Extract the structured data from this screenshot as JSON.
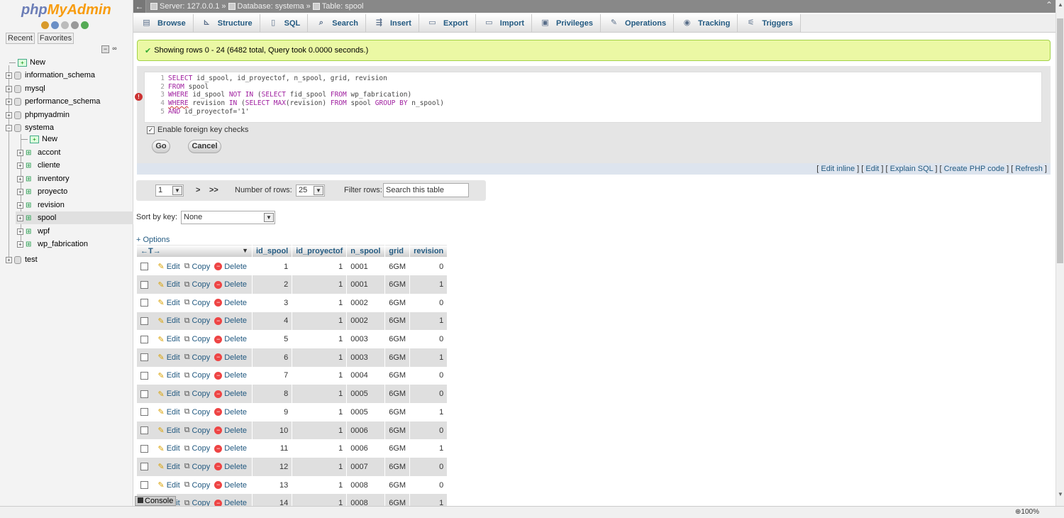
{
  "logo": {
    "part1": "php",
    "part2": "MyAdmin"
  },
  "nav": {
    "recent": "Recent",
    "favorites": "Favorites",
    "new_label": "New",
    "databases": [
      {
        "name": "information_schema"
      },
      {
        "name": "mysql"
      },
      {
        "name": "performance_schema"
      },
      {
        "name": "phpmyadmin"
      },
      {
        "name": "systema"
      },
      {
        "name": "test"
      }
    ],
    "systema_new": "New",
    "tables": [
      "accont",
      "cliente",
      "inventory",
      "proyecto",
      "revision",
      "spool",
      "wpf",
      "wp_fabrication"
    ]
  },
  "breadcrumb": {
    "server": "Server: 127.0.0.1",
    "database": "Database: systema",
    "table": "Table: spool"
  },
  "tabs": [
    "Browse",
    "Structure",
    "SQL",
    "Search",
    "Insert",
    "Export",
    "Import",
    "Privileges",
    "Operations",
    "Tracking",
    "Triggers"
  ],
  "success_message": "Showing rows 0 - 24 (6482 total, Query took 0.0000 seconds.)",
  "sql": {
    "lines": [
      {
        "n": "1",
        "parts": [
          [
            "kw",
            "SELECT"
          ],
          [
            "ct",
            " id_spool, id_proyectof, n_spool, grid, revision"
          ]
        ]
      },
      {
        "n": "2",
        "parts": [
          [
            "kw",
            "FROM"
          ],
          [
            "ct",
            " spool"
          ]
        ]
      },
      {
        "n": "3",
        "parts": [
          [
            "kw",
            "WHERE"
          ],
          [
            "ct",
            " id_spool "
          ],
          [
            "kw",
            "NOT IN"
          ],
          [
            "ct",
            " ("
          ],
          [
            "kw",
            "SELECT"
          ],
          [
            "ct",
            " fid_spool "
          ],
          [
            "kw",
            "FROM"
          ],
          [
            "ct",
            " wp_fabrication)"
          ]
        ]
      },
      {
        "n": "4",
        "parts": [
          [
            "kw",
            "WHERE"
          ],
          [
            "ct",
            " revision "
          ],
          [
            "kw",
            "IN"
          ],
          [
            "ct",
            " ("
          ],
          [
            "kw",
            "SELECT MAX"
          ],
          [
            "ct",
            "(revision) "
          ],
          [
            "kw",
            "FROM"
          ],
          [
            "ct",
            " spool "
          ],
          [
            "kw",
            "GROUP BY"
          ],
          [
            "ct",
            " n_spool)"
          ]
        ]
      },
      {
        "n": "5",
        "parts": [
          [
            "kw",
            "AND"
          ],
          [
            "ct",
            " id_proyectof='1'"
          ]
        ]
      }
    ],
    "fk_label": "Enable foreign key checks",
    "go": "Go",
    "cancel": "Cancel"
  },
  "sql_links": [
    "Edit inline",
    "Edit",
    "Explain SQL",
    "Create PHP code",
    "Refresh"
  ],
  "navigation": {
    "page": "1",
    "next": ">",
    "last": ">>",
    "rows_label": "Number of rows:",
    "rows_value": "25",
    "filter_label": "Filter rows:",
    "filter_placeholder": "Search this table"
  },
  "sort": {
    "label": "Sort by key:",
    "value": "None"
  },
  "options_label": "+ Options",
  "table": {
    "arrows": "←T→",
    "columns": [
      "id_spool",
      "id_proyectof",
      "n_spool",
      "grid",
      "revision"
    ],
    "actions": {
      "edit": "Edit",
      "copy": "Copy",
      "delete": "Delete"
    },
    "rows": [
      [
        "1",
        "1",
        "0001",
        "6GM",
        "0"
      ],
      [
        "2",
        "1",
        "0001",
        "6GM",
        "1"
      ],
      [
        "3",
        "1",
        "0002",
        "6GM",
        "0"
      ],
      [
        "4",
        "1",
        "0002",
        "6GM",
        "1"
      ],
      [
        "5",
        "1",
        "0003",
        "6GM",
        "0"
      ],
      [
        "6",
        "1",
        "0003",
        "6GM",
        "1"
      ],
      [
        "7",
        "1",
        "0004",
        "6GM",
        "0"
      ],
      [
        "8",
        "1",
        "0005",
        "6GM",
        "0"
      ],
      [
        "9",
        "1",
        "0005",
        "6GM",
        "1"
      ],
      [
        "10",
        "1",
        "0006",
        "6GM",
        "0"
      ],
      [
        "11",
        "1",
        "0006",
        "6GM",
        "1"
      ],
      [
        "12",
        "1",
        "0007",
        "6GM",
        "0"
      ],
      [
        "13",
        "1",
        "0008",
        "6GM",
        "0"
      ],
      [
        "14",
        "1",
        "0008",
        "6GM",
        "1"
      ]
    ]
  },
  "console": "Console",
  "zoom": "100%"
}
